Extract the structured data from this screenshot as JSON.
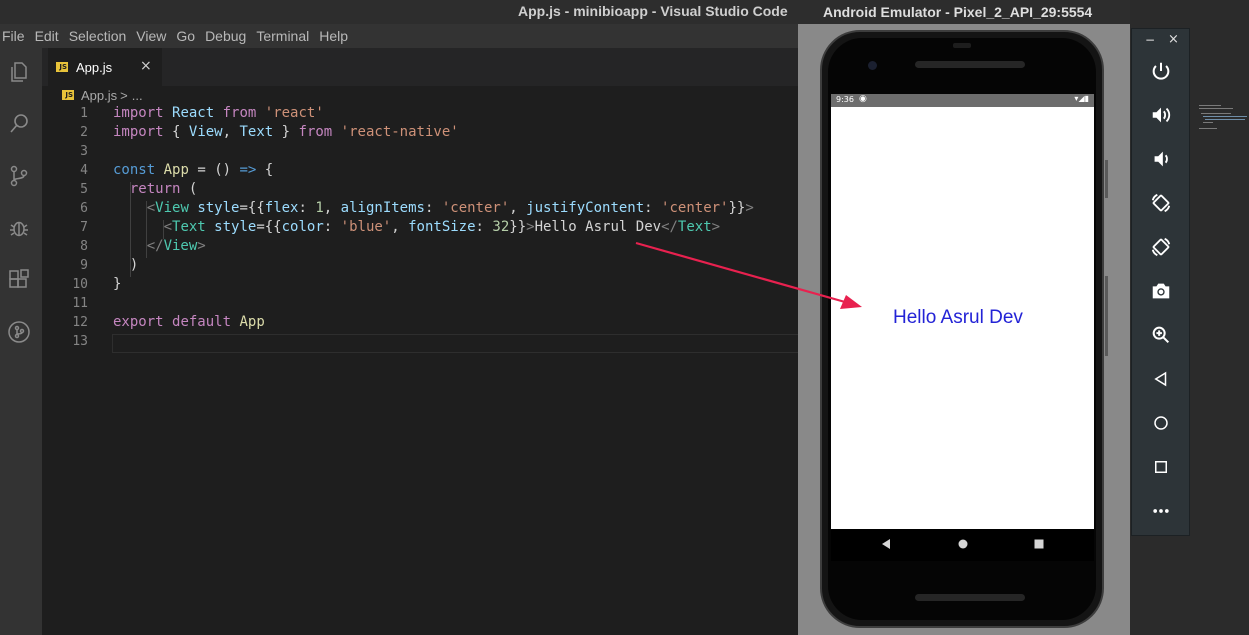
{
  "vscode": {
    "window_title": "App.js - minibioapp - Visual Studio Code",
    "menu": [
      "File",
      "Edit",
      "Selection",
      "View",
      "Go",
      "Debug",
      "Terminal",
      "Help"
    ],
    "activity_icons": [
      "explorer-icon",
      "search-icon",
      "source-control-icon",
      "debug-icon",
      "extensions-icon",
      "git-graph-icon"
    ],
    "tab": {
      "badge": "JS",
      "label": "App.js",
      "close": "×"
    },
    "breadcrumb": {
      "badge": "JS",
      "file": "App.js",
      "separator": ">",
      "rest": "..."
    },
    "code_lines": [
      {
        "n": "1",
        "text": "import React from 'react'"
      },
      {
        "n": "2",
        "text": "import { View, Text } from 'react-native'"
      },
      {
        "n": "3",
        "text": ""
      },
      {
        "n": "4",
        "text": "const App = () => {"
      },
      {
        "n": "5",
        "text": "  return ("
      },
      {
        "n": "6",
        "text": "    <View style={{flex: 1, alignItems: 'center', justifyContent: 'center'}}>"
      },
      {
        "n": "7",
        "text": "      <Text style={{color: 'blue', fontSize: 32}}>Hello Asrul Dev</Text>"
      },
      {
        "n": "8",
        "text": "    </View>"
      },
      {
        "n": "9",
        "text": "  )"
      },
      {
        "n": "10",
        "text": "}"
      },
      {
        "n": "11",
        "text": ""
      },
      {
        "n": "12",
        "text": "export default App"
      },
      {
        "n": "13",
        "text": ""
      }
    ]
  },
  "emulator": {
    "window_title": "Android Emulator - Pixel_2_API_29:5554",
    "status_time": "9:36",
    "hello_text": "Hello Asrul Dev",
    "hello_color": "#2323d6",
    "toolbar": {
      "minimize": "−",
      "close": "×",
      "buttons": [
        "power-icon",
        "volume-up-icon",
        "volume-down-icon",
        "rotate-left-icon",
        "rotate-right-icon",
        "camera-icon",
        "zoom-icon",
        "back-icon",
        "home-icon",
        "overview-icon",
        "more-icon"
      ]
    }
  },
  "colors": {
    "arrow": "#e8214f",
    "editor_bg": "#1e1e1e",
    "keyword": "#c586c0",
    "string": "#ce9178"
  }
}
